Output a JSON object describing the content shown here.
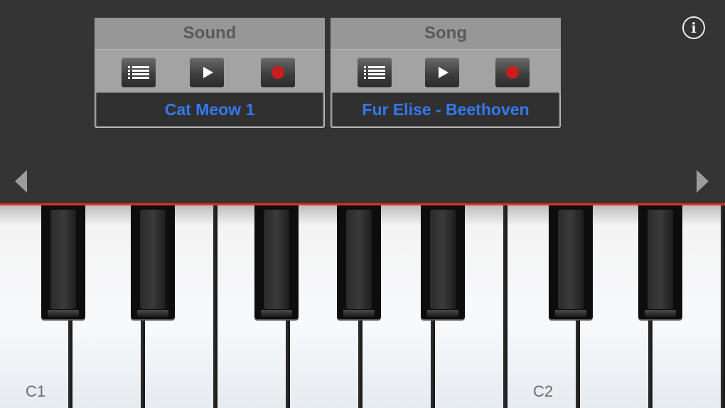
{
  "sound_panel": {
    "title": "Sound",
    "selected_name": "Cat Meow 1",
    "buttons": [
      "list-icon",
      "play-icon",
      "record-icon"
    ]
  },
  "song_panel": {
    "title": "Song",
    "selected_name": "Fur Elise - Beethoven",
    "buttons": [
      "list-icon",
      "play-icon",
      "record-icon"
    ]
  },
  "info_button": {
    "glyph": "i"
  },
  "navigation": {
    "left": "triangle-left-icon",
    "right": "triangle-right-icon"
  },
  "colors": {
    "background": "#343434",
    "accent_text": "#3478f0",
    "record": "#c81e1e",
    "keyboard_line": "#d8322a"
  },
  "keyboard": {
    "white_key_labels": [
      "C1",
      "",
      "",
      "",
      "",
      "",
      "",
      "C2",
      "",
      ""
    ]
  }
}
